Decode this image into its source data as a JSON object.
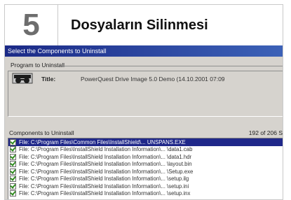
{
  "header": {
    "step_number": "5",
    "title": "Dosyaların Silinmesi"
  },
  "dialog": {
    "title": "Select the Components to Uninstall",
    "program_group_label": "Program to Uninstall",
    "program_icon": "disk-icon",
    "title_label": "Title:",
    "title_value": "PowerQuest Drive Image 5.0 Demo (14.10.2001 07:09",
    "components_label": "Components to Uninstall",
    "components_count": "192 of 206 S",
    "files": [
      "File: C:\\Program Files\\Common Files\\InstallShield\\... UNSPANS.EXE",
      "File: C:\\Program Files\\InstallShield Installation Information\\... \\data1.cab",
      "File: C:\\Program Files\\InstallShield Installation Information\\... \\data1.hdr",
      "File: C:\\Program Files\\InstallShield Installation Information\\... \\layout.bin",
      "File: C:\\Program Files\\InstallShield Installation Information\\... \\Setup.exe",
      "File: C:\\Program Files\\InstallShield Installation Information\\... \\setup.ilg",
      "File: C:\\Program Files\\InstallShield Installation Information\\... \\setup.ini",
      "File: C:\\Program Files\\InstallShield Installation Information\\... \\setup.inx"
    ],
    "selected_index": 0,
    "colors": {
      "selection": "#20288a",
      "titlebar_start": "#1b2a87",
      "titlebar_end": "#3c62b8",
      "check": "#2f8a1f"
    }
  }
}
